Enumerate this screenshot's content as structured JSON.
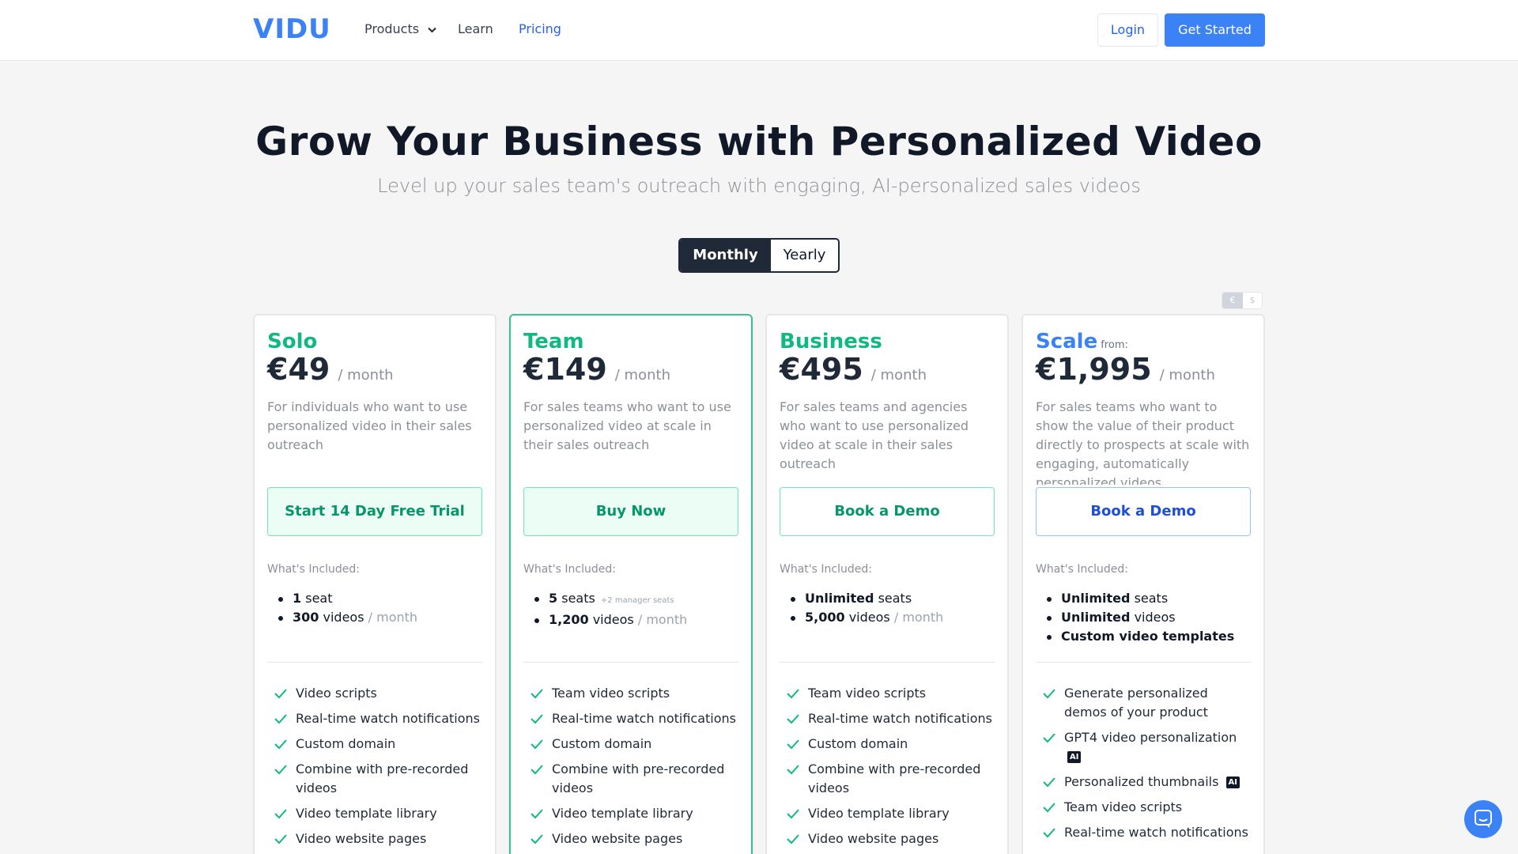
{
  "nav": {
    "logo": "VIDU",
    "products": "Products",
    "learn": "Learn",
    "pricing": "Pricing",
    "login": "Login",
    "get_started": "Get Started"
  },
  "hero": {
    "title": "Grow Your Business with Personalized Video",
    "subtitle": "Level up your sales team's outreach with engaging, AI-personalized sales videos"
  },
  "billing_toggle": {
    "monthly": "Monthly",
    "yearly": "Yearly",
    "selected": "Monthly"
  },
  "currency_toggle": {
    "eur": "€",
    "usd": "$",
    "selected": "€"
  },
  "plans": [
    {
      "name": "Solo",
      "name_color": "#10b981",
      "from": "",
      "price": "€49",
      "period": "/ month",
      "description": "For individuals who want to use personalized video in their sales outreach",
      "cta": "Start 14 Day Free Trial",
      "included_label": "What's Included:",
      "included": [
        {
          "value": "1",
          "text": "seat",
          "note": ""
        },
        {
          "value": "300",
          "text": "videos",
          "note": "/ month"
        }
      ],
      "features": [
        "Video scripts",
        "Real-time watch notifications",
        "Custom domain",
        "Combine with pre-recorded videos",
        "Video template library",
        "Video website pages"
      ]
    },
    {
      "name": "Team",
      "name_color": "#10b981",
      "from": "",
      "price": "€149",
      "period": "/ month",
      "description": "For sales teams who want to use personalized video at scale in their sales outreach",
      "cta": "Buy Now",
      "included_label": "What's Included:",
      "included": [
        {
          "value": "5",
          "text": "seats",
          "note": "+2 manager seats"
        },
        {
          "value": "1,200",
          "text": "videos",
          "note": "/ month"
        }
      ],
      "features": [
        "Team video scripts",
        "Real-time watch notifications",
        "Custom domain",
        "Combine with pre-recorded videos",
        "Video template library",
        "Video website pages"
      ]
    },
    {
      "name": "Business",
      "name_color": "#10b981",
      "from": "",
      "price": "€495",
      "period": "/ month",
      "description": "For sales teams and agencies who want to use personalized video at scale in their sales outreach",
      "cta": "Book a Demo",
      "included_label": "What's Included:",
      "included": [
        {
          "value": "Unlimited",
          "text": "seats",
          "note": ""
        },
        {
          "value": "5,000",
          "text": "videos",
          "note": "/ month"
        }
      ],
      "features": [
        "Team video scripts",
        "Real-time watch notifications",
        "Custom domain",
        "Combine with pre-recorded videos",
        "Video template library",
        "Video website pages"
      ]
    },
    {
      "name": "Scale",
      "name_color": "#3b82f6",
      "from": "from:",
      "price": "€1,995",
      "period": "/ month",
      "description": "For sales teams who want to show the value of their product directly to prospects at scale with engaging, automatically personalized videos",
      "cta": "Book a Demo",
      "included_label": "What's Included:",
      "included": [
        {
          "value": "Unlimited",
          "text": "seats",
          "note": ""
        },
        {
          "value": "Unlimited",
          "text": "videos",
          "note": ""
        },
        {
          "value": "Custom video templates",
          "text": "",
          "note": ""
        }
      ],
      "features": [
        "Generate personalized demos of your product",
        "GPT4 video personalization",
        "Personalized thumbnails",
        "Team video scripts",
        "Real-time watch notifications"
      ],
      "ai_badge": "AI"
    }
  ],
  "colors": {
    "brand": "#3b82f6",
    "green": "#10b981",
    "featured_border": "#34c38f",
    "dark": "#1f2937"
  }
}
